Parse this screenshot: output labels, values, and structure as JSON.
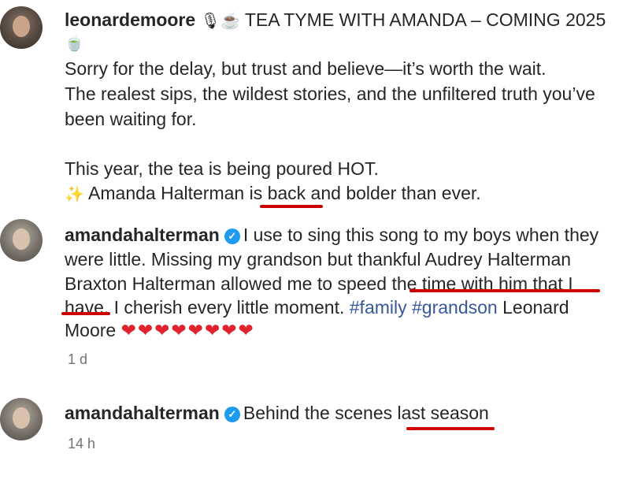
{
  "post": {
    "username": "leonardemoore",
    "title_emoji": "🎙☕",
    "title": "TEA TYME WITH AMANDA – COMING 2025",
    "title_emoji_end": "🍵",
    "lines": [
      "Sorry for the delay, but trust and believe—it’s worth the wait.",
      "The realest sips, the wildest stories, and the unfiltered truth you’ve",
      "been waiting for.",
      "This year, the tea is being poured HOT."
    ],
    "sparkle_emoji": "✨",
    "last_line_pre": "Amanda Halterman ",
    "last_line_mark": "is back",
    "last_line_post": " and bolder than ever."
  },
  "comments": [
    {
      "username": "amandahalterman",
      "verified_glyph": "✓",
      "line1": "I use to sing this song to my boys when they",
      "line2": "were little. Missing my grandson but thankful Audrey Halterman",
      "line3": "Braxton Halterman allowed me to speed the time with him that I",
      "line4_pre": "have. I cherish every little moment. ",
      "tag1": "#family",
      "tag2": "#grandson",
      "line4_post": " Leonard",
      "line5": "Moore",
      "hearts": "❤❤❤❤❤❤❤❤",
      "time": "1 d"
    },
    {
      "username": "amandahalterman",
      "verified_glyph": "✓",
      "text": "Behind the scenes last season",
      "time": "14 h"
    }
  ],
  "colors": {
    "underline": "#cc0000",
    "hashtag": "#385898",
    "verified": "#1d9bf0",
    "meta": "#737373"
  }
}
